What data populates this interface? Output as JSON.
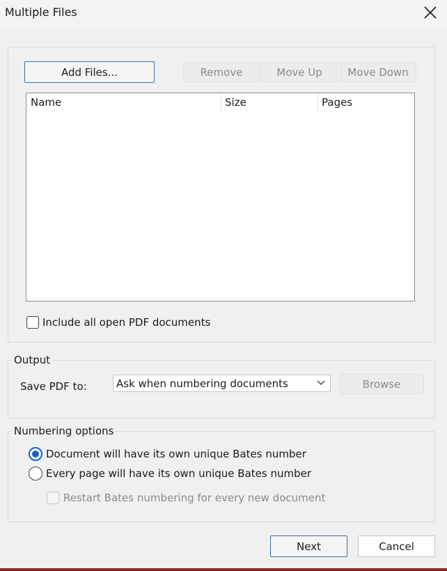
{
  "window": {
    "title": "Multiple Files",
    "close_icon": "close-icon"
  },
  "files": {
    "add_label": "Add Files...",
    "remove_label": "Remove",
    "move_up_label": "Move Up",
    "move_down_label": "Move Down",
    "columns": [
      "Name",
      "Size",
      "Pages"
    ],
    "rows": [],
    "include_open_label": "Include all open PDF documents",
    "include_open_checked": false
  },
  "output": {
    "legend": "Output",
    "save_label": "Save PDF to:",
    "save_value": "Ask when numbering documents",
    "browse_label": "Browse"
  },
  "numbering": {
    "legend": "Numbering options",
    "option_document": "Document will have its own unique Bates number",
    "option_page": "Every page will have its own unique Bates number",
    "selected": "document",
    "restart_label": "Restart Bates numbering for every new document",
    "restart_checked": false
  },
  "footer": {
    "next_label": "Next",
    "cancel_label": "Cancel"
  },
  "colors": {
    "accent": "#1565c0",
    "dialog_bg": "#f0f0f0"
  }
}
